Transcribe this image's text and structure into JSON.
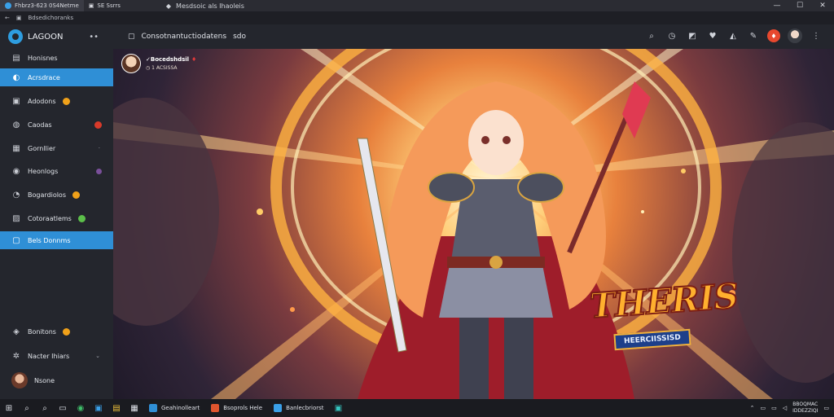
{
  "window": {
    "tabs": [
      {
        "label": "Fhbrz3-623 0S4Netme"
      },
      {
        "label": "SE Ssrrs"
      }
    ],
    "title": "Mesdsoic als Ihaoleis",
    "controls": {
      "minimize": "—",
      "maximize": "☐",
      "close": "✕"
    }
  },
  "address": {
    "url": "Bdsedichoranks"
  },
  "brand": {
    "name": "LAGOON",
    "more": "••"
  },
  "sidebar": {
    "items": [
      {
        "label": "Honisnes",
        "icon": "home-icon",
        "glyph": "▤"
      },
      {
        "label": "Acrsdrace",
        "icon": "compass-icon",
        "glyph": "◐"
      },
      {
        "label": "Adodons",
        "icon": "bag-icon",
        "glyph": "▣"
      },
      {
        "label": "Caodas",
        "icon": "globe-icon",
        "glyph": "◍"
      },
      {
        "label": "Gornllier",
        "icon": "grid-icon",
        "glyph": "▦"
      },
      {
        "label": "Heonlogs",
        "icon": "pin-icon",
        "glyph": "◉"
      },
      {
        "label": "Bogardiolos",
        "icon": "chat-icon",
        "glyph": "◔"
      },
      {
        "label": "Cotoraatlems",
        "icon": "image-icon",
        "glyph": "▨"
      },
      {
        "label": "Bels Donnms",
        "icon": "folder-icon",
        "glyph": "▢"
      }
    ],
    "bottom_items": [
      {
        "label": "Bonitons",
        "icon": "users-icon",
        "glyph": "◈"
      },
      {
        "label": "Nacter Ihiars",
        "icon": "settings-icon",
        "glyph": "✲"
      },
      {
        "label": "Nsone",
        "icon": "avatar-icon"
      }
    ],
    "colors": {
      "accent": "#2f8fd6",
      "badge_orange": "#f0a11a",
      "badge_red": "#d83a2a",
      "badge_purple": "#7a4f9a",
      "badge_green": "#5cbf4a"
    }
  },
  "topbar": {
    "title": "Consotnantuctiodatens",
    "suffix": "sdo"
  },
  "post": {
    "author": "✓Bocedshdsil",
    "meta": "◷ 1 ACSISSA"
  },
  "artwork": {
    "logo_title": "THERIS",
    "logo_sub": "HEERCIISSISD"
  },
  "taskbar": {
    "apps": [
      {
        "label": "Geahinolleart",
        "color": "#2f8fd6"
      },
      {
        "label": "Bsoprols Hele",
        "color": "#e0552e"
      },
      {
        "label": "Banlecbriorst",
        "color": "#3aa0e8"
      }
    ],
    "clock_line1": "BBOQMAC",
    "clock_line2": "IDDEZZIQI"
  }
}
